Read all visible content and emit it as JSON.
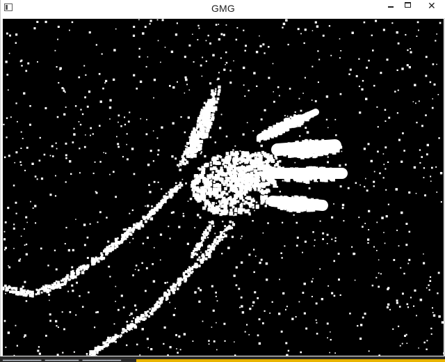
{
  "window": {
    "title": "GMG",
    "close_glyph": "✕",
    "icons": {
      "app": "app-window-icon",
      "minimize": "minimize-icon",
      "maximize": "maximize-icon",
      "close": "close-icon"
    }
  },
  "viewer": {
    "description_visible": false
  },
  "taskbar": {
    "status_text": "▁▁▁▁▁▁▁▁  ▁▁▁▁▁▁▁  ▁▁▁▁▁▁▁▁",
    "accent_color": "#e8b400"
  },
  "colors": {
    "canvas_background": "#000000",
    "foreground_pixels": "#ffffff"
  }
}
